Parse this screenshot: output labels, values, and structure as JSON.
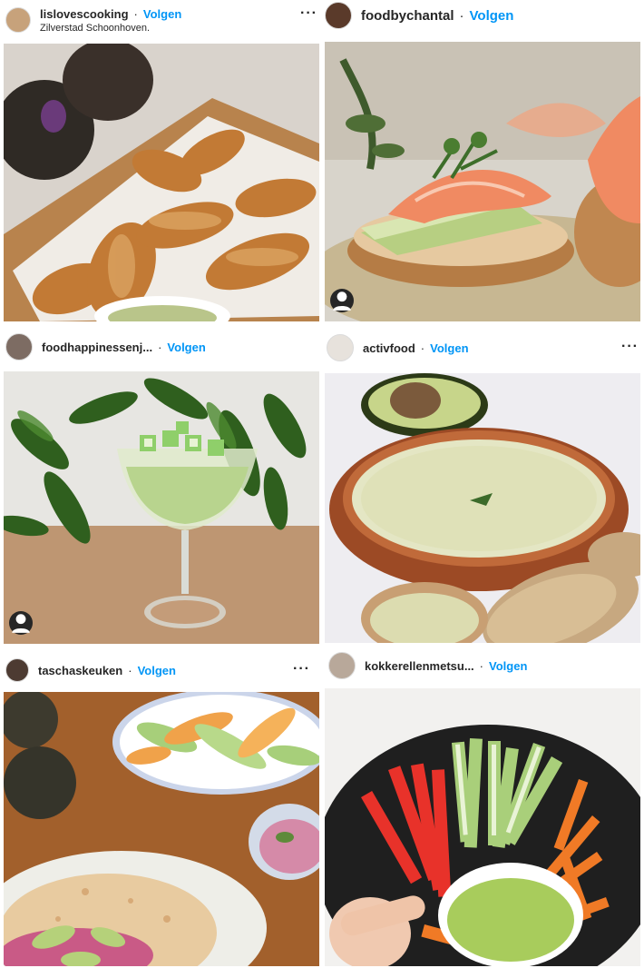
{
  "posts": [
    {
      "username": "lislovescooking",
      "follow": "Volgen",
      "separator": "·",
      "location": "Zilverstad Schoonhoven.",
      "more": "···",
      "avatar_color": "#c7a27b",
      "image": "fried-chicken-avocado-photo"
    },
    {
      "username": "foodbychantal",
      "follow": "Volgen",
      "separator": "·",
      "more": "",
      "avatar_color": "#5a3a2a",
      "image": "salmon-avocado-toast-photo",
      "tag_icon": "person-tag-icon"
    },
    {
      "username": "foodhappinessenj...",
      "follow": "Volgen",
      "separator": "·",
      "more": "",
      "avatar_color": "#7d6c63",
      "image": "avocado-cocktail-glass-photo",
      "tag_icon": "person-tag-icon"
    },
    {
      "username": "activfood",
      "follow": "Volgen",
      "separator": "·",
      "more": "···",
      "avatar_color": "#e7e2dc",
      "image": "avocado-dip-bowl-photo"
    },
    {
      "username": "taschaskeuken",
      "follow": "Volgen",
      "separator": "·",
      "more": "···",
      "avatar_color": "#4d3b32",
      "image": "wrap-salad-hummus-photo"
    },
    {
      "username": "kokkerellenmetsu...",
      "follow": "Volgen",
      "separator": "·",
      "more": "",
      "avatar_color": "#b8a89a",
      "image": "veggie-sticks-dip-photo"
    }
  ],
  "colors": {
    "link": "#0095f6",
    "text": "#262626",
    "background": "#ffffff"
  }
}
